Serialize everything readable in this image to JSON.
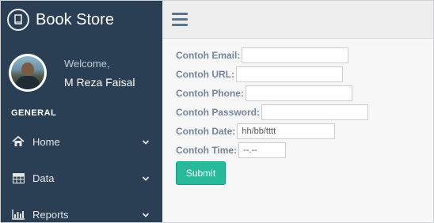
{
  "brand": {
    "title": "Book Store",
    "icon": "book-icon"
  },
  "profile": {
    "greeting": "Welcome,",
    "name": "M Reza Faisal"
  },
  "sidebar": {
    "section": "GENERAL",
    "items": [
      {
        "label": "Home",
        "icon": "home-icon"
      },
      {
        "label": "Data",
        "icon": "table-icon"
      },
      {
        "label": "Reports",
        "icon": "bar-chart-icon"
      }
    ]
  },
  "form": {
    "email": {
      "label": "Contoh Email:",
      "value": "",
      "placeholder": ""
    },
    "url": {
      "label": "Contoh URL:",
      "value": "",
      "placeholder": ""
    },
    "phone": {
      "label": "Contoh Phone:",
      "value": "",
      "placeholder": ""
    },
    "password": {
      "label": "Contoh Password:",
      "value": "",
      "placeholder": ""
    },
    "date": {
      "label": "Contoh Date:",
      "value": "",
      "placeholder": "hh/bb/tttt"
    },
    "time": {
      "label": "Contoh Time:",
      "value": "",
      "placeholder": "--.--"
    },
    "submit_label": "Submit"
  },
  "colors": {
    "sidebar_bg": "#2a3f54",
    "accent": "#26b99a",
    "label": "#73879c"
  }
}
